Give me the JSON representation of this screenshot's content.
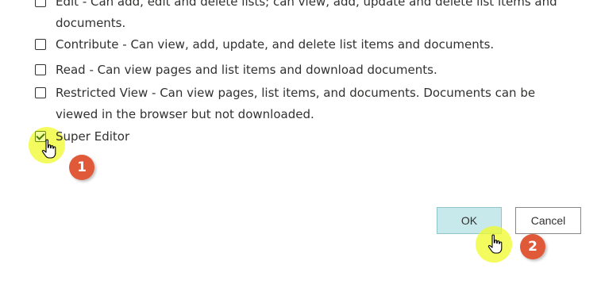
{
  "permissions": [
    {
      "text": "Edit - Can add, edit and delete lists; can view, add, update and delete list items and documents.",
      "checked": false
    },
    {
      "text": "Contribute - Can view, add, update, and delete list items and documents.",
      "checked": false
    },
    {
      "text": "Read - Can view pages and list items and download documents.",
      "checked": false
    },
    {
      "text": "Restricted View - Can view pages, list items, and documents. Documents can be viewed in the browser but not downloaded.",
      "checked": false
    },
    {
      "text": "Super Editor",
      "checked": true
    }
  ],
  "buttons": {
    "ok_label": "OK",
    "cancel_label": "Cancel"
  },
  "steps": {
    "step1": "1",
    "step2": "2"
  },
  "colors": {
    "highlight": "#f0fa28",
    "badge": "#e05a3a",
    "ok_bg": "#c8e9eb"
  },
  "icons": {
    "cursor": "hand-pointer-icon",
    "checkbox": "checkbox-icon"
  }
}
